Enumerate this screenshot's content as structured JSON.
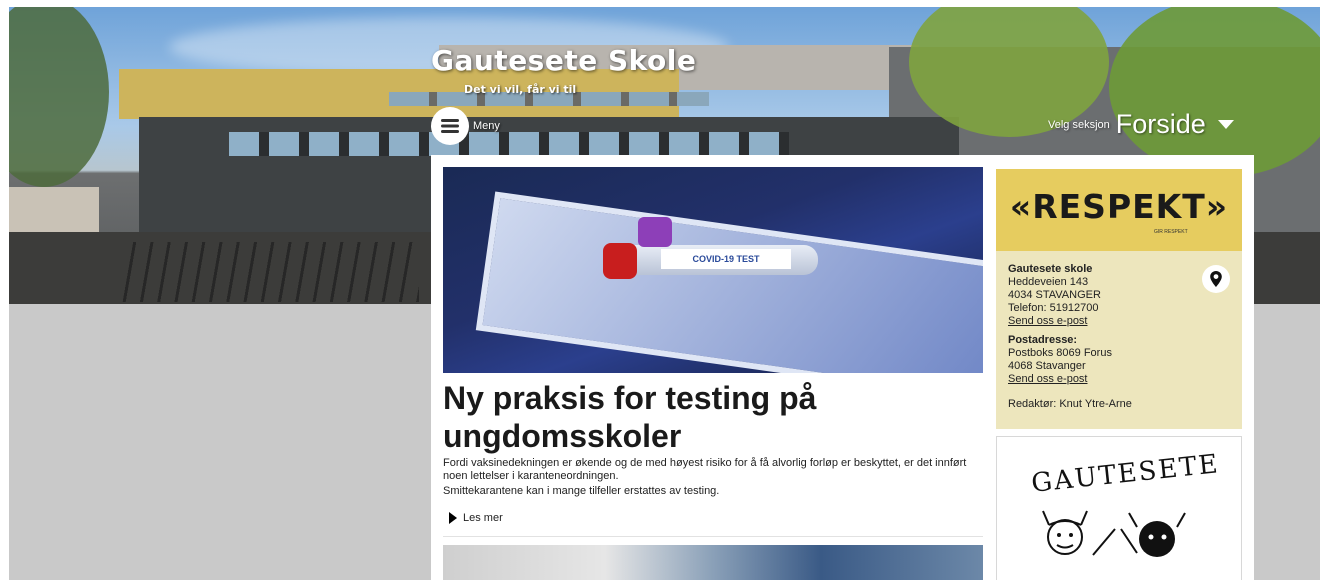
{
  "header": {
    "title": "Gautesete Skole",
    "tagline": "Det vi vil, får vi til",
    "menu_label": "Meny",
    "section_label": "Velg seksjon",
    "section_value": "Forside"
  },
  "article": {
    "image_label": "COVID-19 TEST",
    "title": "Ny praksis for testing på ungdomsskoler",
    "summary_line1": "Fordi vaksinedekningen er økende og de med høyest risiko for å få alvorlig forløp er beskyttet, er det innført noen lettelser i karanteneordningen.",
    "summary_line2": "Smittekarantene kan i mange tilfeller erstattes av testing.",
    "read_more": "Les mer"
  },
  "sidebar": {
    "respekt_text": "«RESPEKT»",
    "respekt_sub": "GIR RESPEKT",
    "contact": {
      "school_name": "Gautesete skole",
      "street": "Heddeveien 143",
      "city": "4034 STAVANGER",
      "phone": "Telefon: 51912700",
      "email_link": "Send oss e-post",
      "postal_heading": "Postadresse:",
      "postal_box": "Postboks 8069 Forus",
      "postal_city": "4068 Stavanger",
      "postal_email_link": "Send oss e-post",
      "editor": "Redaktør: Knut Ytre-Arne"
    },
    "logo_text": "GAUTESETE"
  },
  "colors": {
    "page_bg": "#c9c9c9",
    "respekt_bg": "#e6cc5f",
    "contact_bg": "#ede6bd"
  }
}
